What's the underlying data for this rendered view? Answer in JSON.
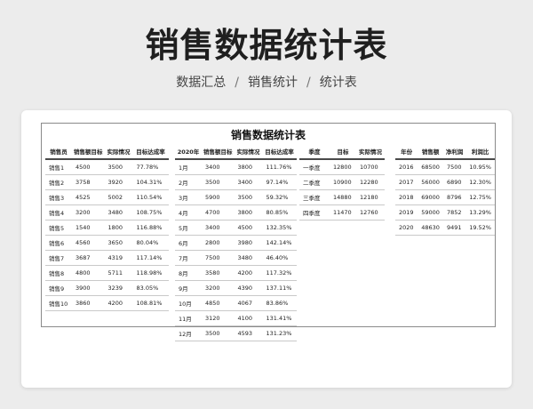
{
  "title": "销售数据统计表",
  "breadcrumb": [
    "数据汇总",
    "销售统计",
    "统计表"
  ],
  "breadcrumb_sep": "/",
  "sheet_title": "销售数据统计表",
  "tables": [
    {
      "headers": [
        "销售员",
        "销售额目标",
        "实际情况",
        "目标达成率"
      ],
      "rows": [
        [
          "销售1",
          "4500",
          "3500",
          "77.78%"
        ],
        [
          "销售2",
          "3758",
          "3920",
          "104.31%"
        ],
        [
          "销售3",
          "4525",
          "5002",
          "110.54%"
        ],
        [
          "销售4",
          "3200",
          "3480",
          "108.75%"
        ],
        [
          "销售5",
          "1540",
          "1800",
          "116.88%"
        ],
        [
          "销售6",
          "4560",
          "3650",
          "80.04%"
        ],
        [
          "销售7",
          "3687",
          "4319",
          "117.14%"
        ],
        [
          "销售8",
          "4800",
          "5711",
          "118.98%"
        ],
        [
          "销售9",
          "3900",
          "3239",
          "83.05%"
        ],
        [
          "销售10",
          "3860",
          "4200",
          "108.81%"
        ]
      ]
    },
    {
      "headers": [
        "2020年",
        "销售额目标",
        "实际情况",
        "目标达成率"
      ],
      "rows": [
        [
          "1月",
          "3400",
          "3800",
          "111.76%"
        ],
        [
          "2月",
          "3500",
          "3400",
          "97.14%"
        ],
        [
          "3月",
          "5900",
          "3500",
          "59.32%"
        ],
        [
          "4月",
          "4700",
          "3800",
          "80.85%"
        ],
        [
          "5月",
          "3400",
          "4500",
          "132.35%"
        ],
        [
          "6月",
          "2800",
          "3980",
          "142.14%"
        ],
        [
          "7月",
          "7500",
          "3480",
          "46.40%"
        ],
        [
          "8月",
          "3580",
          "4200",
          "117.32%"
        ],
        [
          "9月",
          "3200",
          "4390",
          "137.11%"
        ],
        [
          "10月",
          "4850",
          "4067",
          "83.86%"
        ],
        [
          "11月",
          "3120",
          "4100",
          "131.41%"
        ],
        [
          "12月",
          "3500",
          "4593",
          "131.23%"
        ]
      ]
    },
    {
      "headers": [
        "季度",
        "目标",
        "实际情况"
      ],
      "rows": [
        [
          "一季度",
          "12800",
          "10700"
        ],
        [
          "二季度",
          "10900",
          "12280"
        ],
        [
          "三季度",
          "14880",
          "12180"
        ],
        [
          "四季度",
          "11470",
          "12760"
        ]
      ]
    },
    {
      "headers": [
        "年份",
        "销售额",
        "净利润",
        "利润比"
      ],
      "rows": [
        [
          "2016",
          "68500",
          "7500",
          "10.95%"
        ],
        [
          "2017",
          "56000",
          "6890",
          "12.30%"
        ],
        [
          "2018",
          "69000",
          "8796",
          "12.75%"
        ],
        [
          "2019",
          "59000",
          "7852",
          "13.29%"
        ],
        [
          "2020",
          "48630",
          "9491",
          "19.52%"
        ]
      ]
    }
  ]
}
